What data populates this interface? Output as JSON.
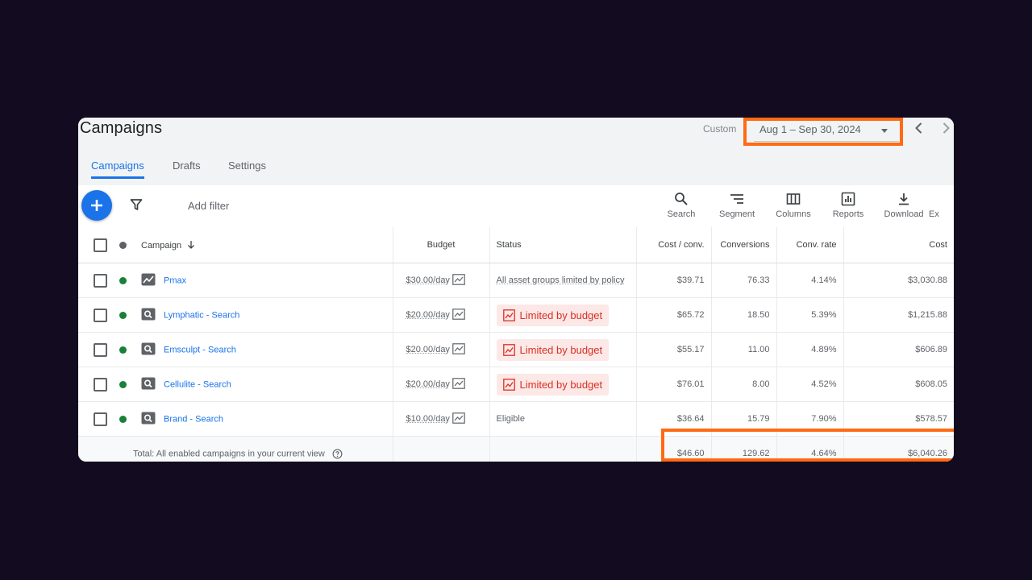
{
  "header": {
    "title": "Campaigns",
    "custom_label": "Custom",
    "date_range": "Aug 1 – Sep 30, 2024",
    "prev_label": "‹",
    "next_label": "›"
  },
  "tabs": [
    {
      "label": "Campaigns",
      "active": true
    },
    {
      "label": "Drafts",
      "active": false
    },
    {
      "label": "Settings",
      "active": false
    }
  ],
  "toolbar": {
    "add_filter": "Add filter",
    "tools": [
      {
        "label": "Search",
        "icon": "search-icon"
      },
      {
        "label": "Segment",
        "icon": "segment-icon"
      },
      {
        "label": "Columns",
        "icon": "columns-icon"
      },
      {
        "label": "Reports",
        "icon": "reports-icon"
      },
      {
        "label": "Download",
        "icon": "download-icon"
      },
      {
        "label": "Ex",
        "icon": "expand-icon"
      }
    ]
  },
  "table": {
    "columns": {
      "campaign": "Campaign",
      "budget": "Budget",
      "status": "Status",
      "cost_conv": "Cost / conv.",
      "conversions": "Conversions",
      "conv_rate": "Conv. rate",
      "cost": "Cost"
    },
    "rows": [
      {
        "name": "Pmax",
        "type": "pmax",
        "budget": "$30.00/day",
        "status": "All asset groups limited by policy",
        "status_type": "text",
        "cost_conv": "$39.71",
        "conversions": "76.33",
        "conv_rate": "4.14%",
        "cost": "$3,030.88"
      },
      {
        "name": "Lymphatic - Search",
        "type": "search",
        "budget": "$20.00/day",
        "status": "Limited by budget",
        "status_type": "limited",
        "cost_conv": "$65.72",
        "conversions": "18.50",
        "conv_rate": "5.39%",
        "cost": "$1,215.88"
      },
      {
        "name": "Emsculpt - Search",
        "type": "search",
        "budget": "$20.00/day",
        "status": "Limited by budget",
        "status_type": "limited",
        "cost_conv": "$55.17",
        "conversions": "11.00",
        "conv_rate": "4.89%",
        "cost": "$606.89"
      },
      {
        "name": "Cellulite - Search",
        "type": "search",
        "budget": "$20.00/day",
        "status": "Limited by budget",
        "status_type": "limited",
        "cost_conv": "$76.01",
        "conversions": "8.00",
        "conv_rate": "4.52%",
        "cost": "$608.05"
      },
      {
        "name": "Brand - Search",
        "type": "search",
        "budget": "$10.00/day",
        "status": "Eligible",
        "status_type": "text",
        "cost_conv": "$36.64",
        "conversions": "15.79",
        "conv_rate": "7.90%",
        "cost": "$578.57"
      }
    ],
    "total": {
      "label": "Total: All enabled campaigns in your current view",
      "cost_conv": "$46.60",
      "conversions": "129.62",
      "conv_rate": "4.64%",
      "cost": "$6,040.26"
    }
  },
  "colors": {
    "accent": "#1a73e8",
    "highlight": "#ff6a13",
    "enabled": "#188038",
    "limited": "#d93025"
  }
}
